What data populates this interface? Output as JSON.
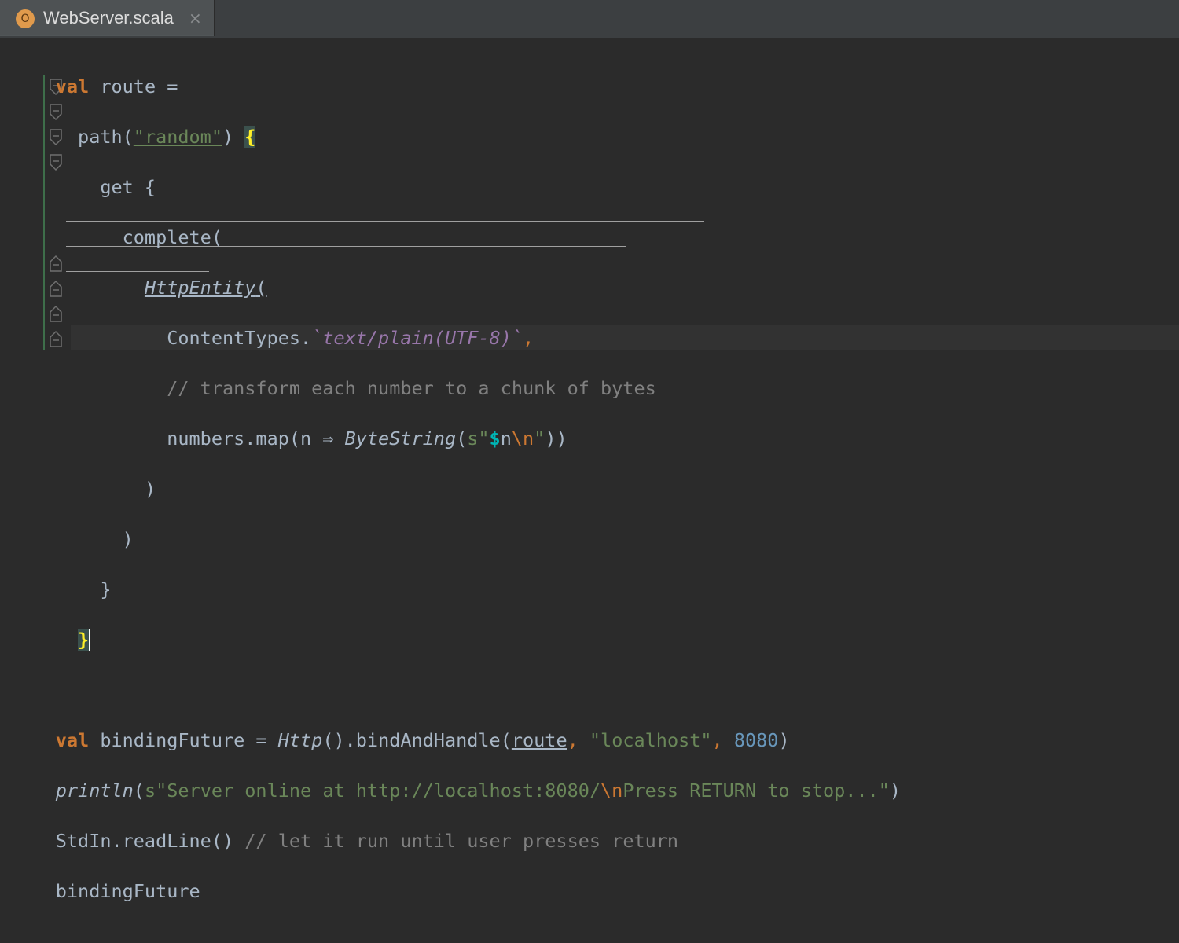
{
  "tab": {
    "icon_letter": "O",
    "title": "WebServer.scala",
    "close": "×"
  },
  "code": {
    "l1": {
      "kw": "val",
      "rest": " route ="
    },
    "l2": {
      "a": "path(",
      "str": "\"random\"",
      "b": ") ",
      "brace": "{"
    },
    "l3": {
      "text": "get {"
    },
    "l4": {
      "text": "complete("
    },
    "l5": {
      "cls": "HttpEntity",
      "paren": "("
    },
    "l6": {
      "a": "ContentTypes.",
      "b": "`text/plain(UTF-8)`",
      "c": ","
    },
    "l7": {
      "text": "// transform each number to a chunk of bytes"
    },
    "l8": {
      "a": "numbers.map(n ⇒ ",
      "fn": "ByteString",
      "b": "(",
      "s": "s\"",
      "dol": "$",
      "n": "n",
      "esc": "\\n",
      "q": "\"",
      "c": "))"
    },
    "l9": {
      "text": ")"
    },
    "l10": {
      "text": ")"
    },
    "l11": {
      "text": "}"
    },
    "l12": {
      "brace": "}"
    },
    "l14": {
      "kw": "val",
      "a": " bindingFuture = ",
      "fn": "Http",
      "b": "().bindAndHandle(",
      "route": "route",
      "c": ", ",
      "str": "\"localhost\"",
      "d": ", ",
      "num": "8080",
      "e": ")"
    },
    "l15": {
      "fn": "println",
      "a": "(",
      "s1": "s\"Server online at http://localhost:8080/",
      "esc": "\\n",
      "s2": "Press RETURN to stop...\"",
      "b": ")"
    },
    "l16": {
      "a": "StdIn.readLine() ",
      "cmt": "// let it run until user presses return"
    },
    "l17": {
      "text": "bindingFuture"
    }
  }
}
